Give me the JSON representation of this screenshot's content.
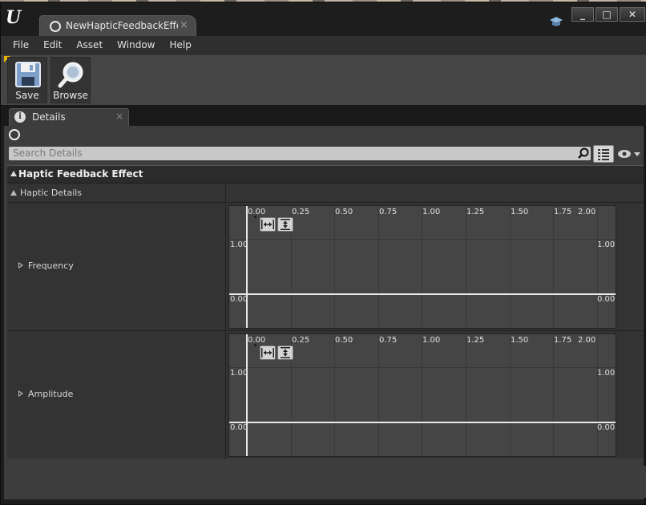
{
  "window": {
    "tab_title": "NewHapticFeedbackEffe*",
    "tab_close": "×",
    "controls": {
      "minimize": "_",
      "maximize": "□",
      "close": "✕"
    }
  },
  "menu": [
    "File",
    "Edit",
    "Asset",
    "Window",
    "Help"
  ],
  "toolbar": {
    "save_label": "Save",
    "browse_label": "Browse"
  },
  "details_tab": {
    "label": "Details",
    "close": "×",
    "icon_glyph": "i"
  },
  "search": {
    "placeholder": "Search Details"
  },
  "category": {
    "label": "Haptic Feedback Effect"
  },
  "subcategory": {
    "label": "Haptic Details"
  },
  "properties": [
    {
      "label": "Frequency"
    },
    {
      "label": "Amplitude"
    }
  ],
  "curve_editor": {
    "x_ticks": [
      "0.00",
      "0.25",
      "0.50",
      "0.75",
      "1.00",
      "1.25",
      "1.50",
      "1.75",
      "2.00"
    ],
    "y_ticks": {
      "top": "1.00",
      "bottom": "0.00"
    }
  },
  "colors": {
    "accent": "#e8b700",
    "panel": "#3d3d3d",
    "curve_bg": "#454545"
  }
}
